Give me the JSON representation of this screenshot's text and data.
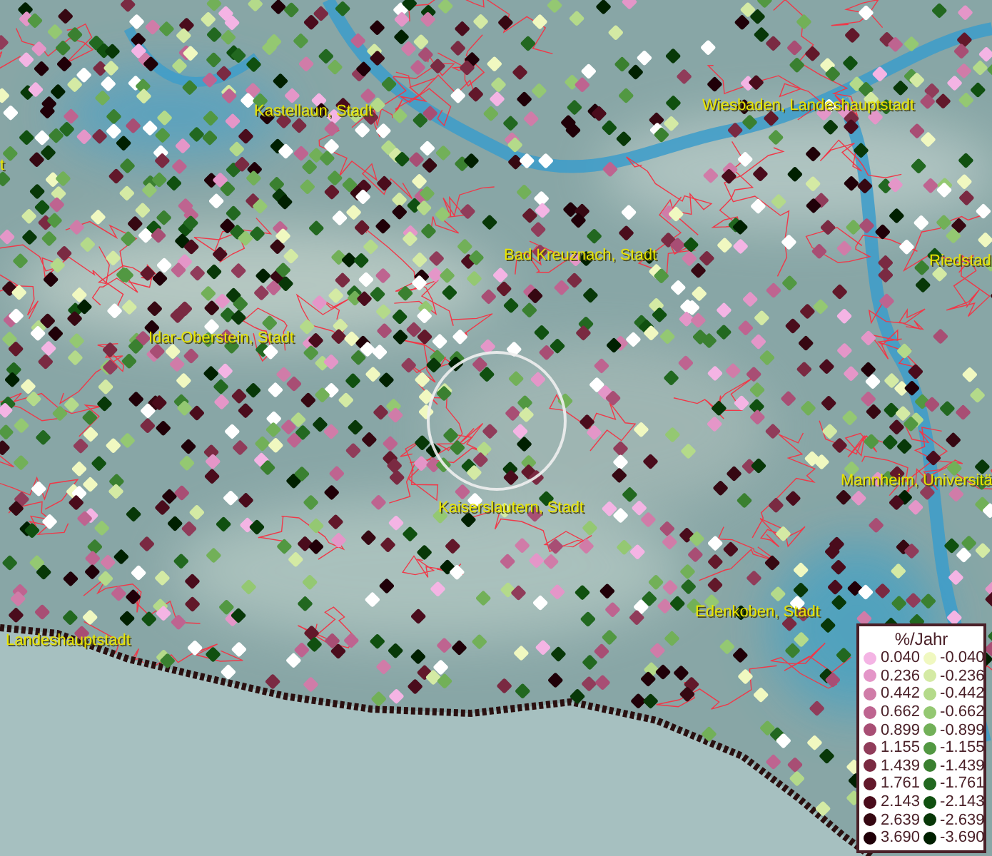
{
  "map": {
    "place_labels": [
      {
        "label": "t"
      },
      {
        "label": "Kastellaun, Stadt"
      },
      {
        "label": "Wiesbaden, Landeshauptstadt"
      },
      {
        "label": "Bad Kreuznach, Stadt"
      },
      {
        "label": "Riedstad"
      },
      {
        "label": "Idar-Oberstein, Stadt"
      },
      {
        "label": "Kaiserslautern, Stadt"
      },
      {
        "label": "Mannheim, Universitä"
      },
      {
        "label": "Edenkoben, Stadt"
      },
      {
        "label": "Landeshauptstadt"
      }
    ]
  },
  "legend": {
    "title": "%/Jahr",
    "items": [
      {
        "label": "0.040",
        "color": "#f4b4e4"
      },
      {
        "label": "-0.040",
        "color": "#f0f8c0"
      },
      {
        "label": "0.236",
        "color": "#e496c8"
      },
      {
        "label": "-0.236",
        "color": "#d4eaa4"
      },
      {
        "label": "0.442",
        "color": "#d07ca8"
      },
      {
        "label": "-0.442",
        "color": "#b4da8a"
      },
      {
        "label": "0.662",
        "color": "#be6490"
      },
      {
        "label": "-0.662",
        "color": "#94c872"
      },
      {
        "label": "0.899",
        "color": "#a84e74"
      },
      {
        "label": "-0.899",
        "color": "#72b058"
      },
      {
        "label": "1.155",
        "color": "#903c5a"
      },
      {
        "label": "-1.155",
        "color": "#529842"
      },
      {
        "label": "1.439",
        "color": "#7a2a42"
      },
      {
        "label": "-1.439",
        "color": "#3a8030"
      },
      {
        "label": "1.761",
        "color": "#62182a"
      },
      {
        "label": "-1.761",
        "color": "#226820"
      },
      {
        "label": "2.143",
        "color": "#4a0c1c"
      },
      {
        "label": "-2.143",
        "color": "#105010"
      },
      {
        "label": "2.639",
        "color": "#360812"
      },
      {
        "label": "-2.639",
        "color": "#083808"
      },
      {
        "label": "3.690",
        "color": "#200008"
      },
      {
        "label": "-3.690",
        "color": "#002000"
      }
    ]
  }
}
